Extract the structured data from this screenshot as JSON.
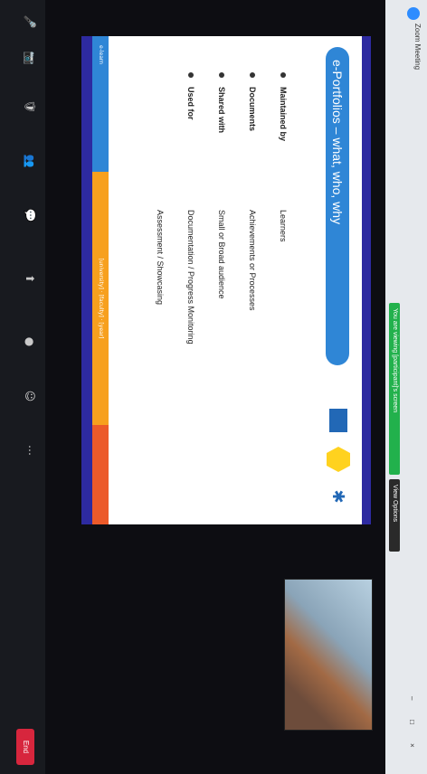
{
  "app": {
    "title": "Zoom Meeting",
    "share_banner": "You are viewing [participant]'s screen",
    "view_options": "View Options",
    "window_controls": [
      "–",
      "□",
      "×"
    ]
  },
  "slide": {
    "title": "e-Portfolios – what, who, why",
    "rows": [
      {
        "label": "Maintained by",
        "value": "Learners"
      },
      {
        "label": "Documents",
        "value": "Achievements or Processes"
      },
      {
        "label": "Shared with",
        "value": "Small or Broad audience"
      },
      {
        "label": "Used for",
        "value": "Documentation / Progress Monitoring"
      },
      {
        "label": "",
        "value": "Assessment / Showcasing"
      }
    ],
    "footer_left": "e-learn",
    "footer_middle": "[university] · [faculty] · [year]"
  },
  "participant": {
    "name": ""
  },
  "toolbar": {
    "icons": [
      "mic-icon",
      "video-icon",
      "security-icon",
      "participants-icon",
      "chat-icon",
      "share-icon",
      "record-icon",
      "reactions-icon",
      "more-icon"
    ],
    "end_label": "End"
  },
  "colors": {
    "title_pill": "#2f86d6",
    "frame_blue": "#2d2aa0",
    "footer_orange": "#f7a01e",
    "end_red": "#d7263d"
  }
}
